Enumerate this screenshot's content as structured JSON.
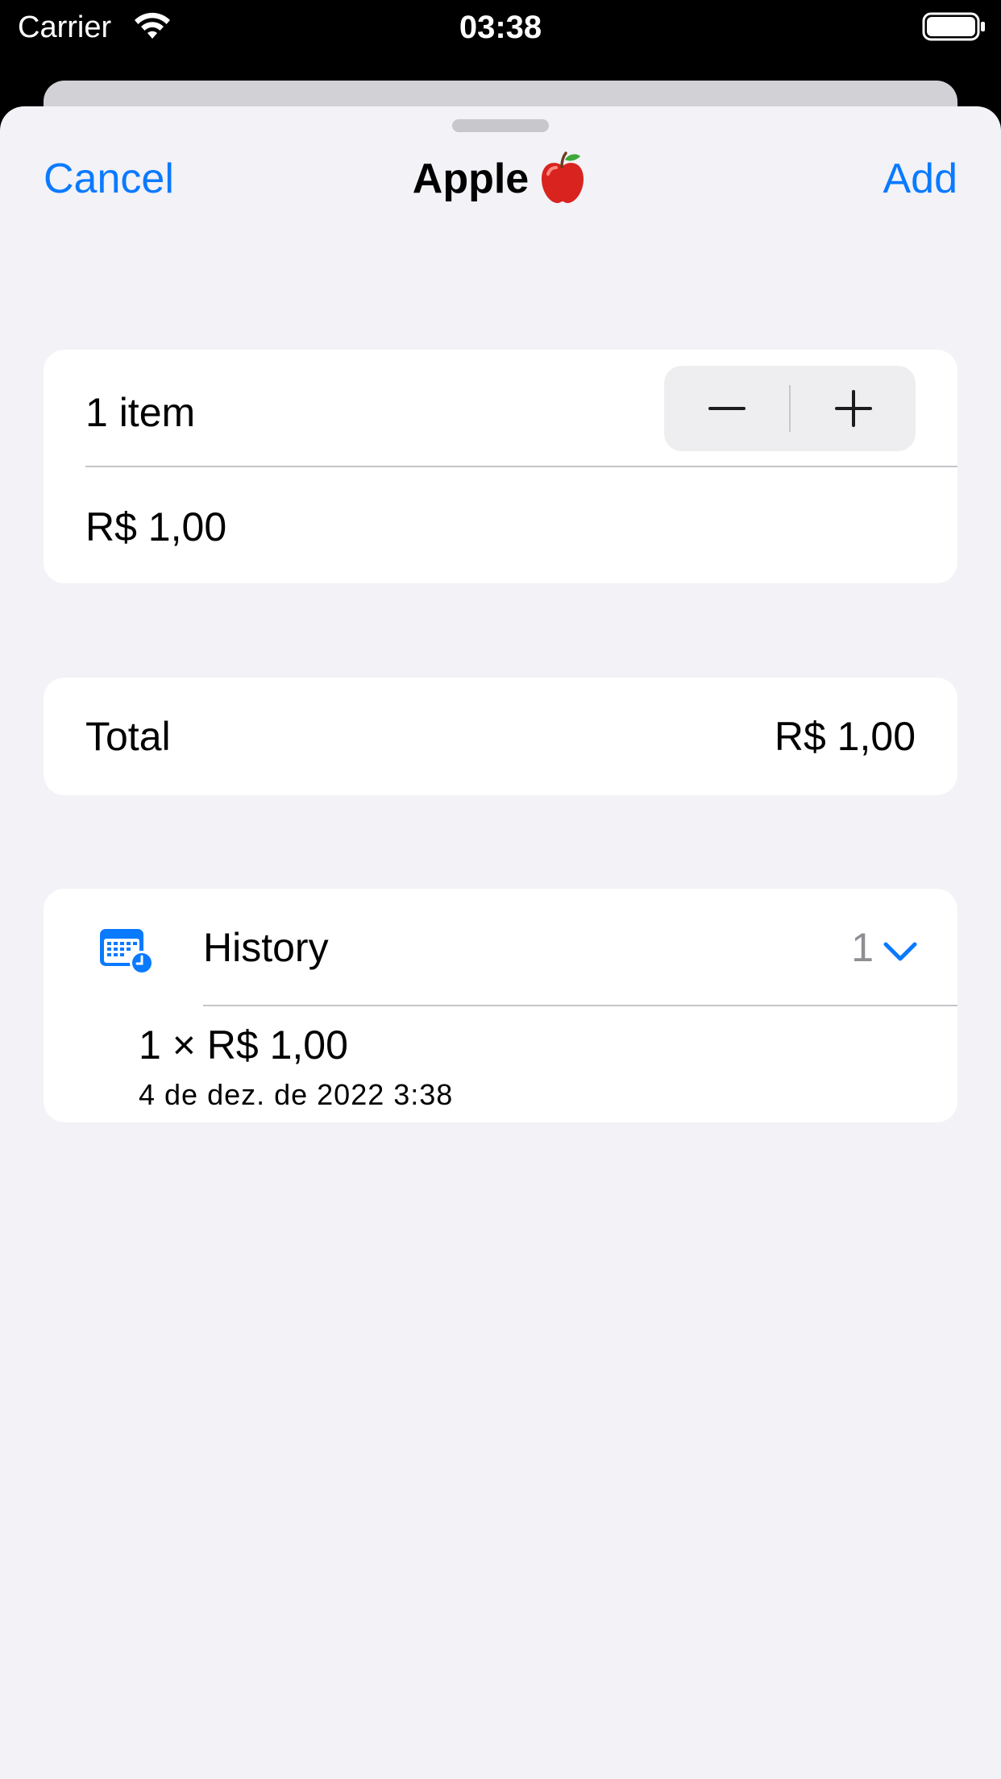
{
  "status_bar": {
    "carrier": "Carrier",
    "time": "03:38"
  },
  "nav": {
    "cancel_label": "Cancel",
    "title": "Apple",
    "title_icon": "red-apple-icon",
    "add_label": "Add"
  },
  "quantity_card": {
    "quantity_label": "1 item",
    "price": "R$ 1,00",
    "stepper": {
      "minus_icon": "minus-icon",
      "plus_icon": "plus-icon"
    }
  },
  "total_card": {
    "label": "Total",
    "value": "R$ 1,00"
  },
  "history_card": {
    "icon": "calendar-clock-icon",
    "label": "History",
    "count": "1",
    "expand_icon": "chevron-down-icon",
    "entries": [
      {
        "summary": "1 × R$ 1,00",
        "date": "4 de dez. de 2022 3:38"
      }
    ]
  },
  "colors": {
    "accent": "#0a7aff",
    "background": "#f2f2f7",
    "card": "#ffffff",
    "secondary_text": "#8e8e93"
  }
}
